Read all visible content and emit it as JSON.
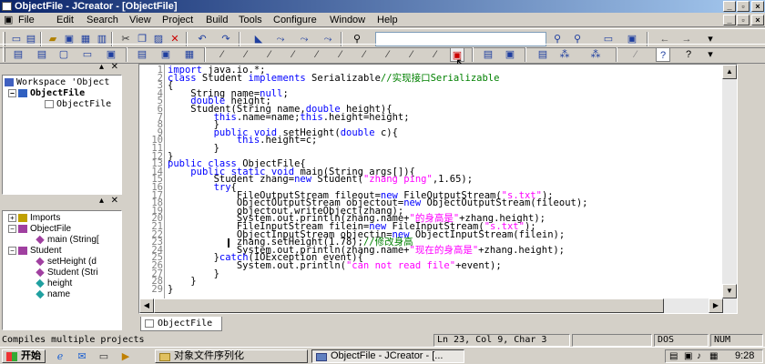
{
  "window": {
    "title": "ObjectFile - JCreator - [ObjectFile]"
  },
  "menu": [
    "File",
    "Edit",
    "Search",
    "View",
    "Project",
    "Build",
    "Tools",
    "Configure",
    "Window",
    "Help"
  ],
  "workspace": {
    "items": [
      "Workspace 'Object",
      "ObjectFile",
      "ObjectFile"
    ]
  },
  "classview": {
    "items": [
      "Imports",
      "ObjectFile",
      "main (String[",
      "Student",
      "setHeight (d",
      "Student (Stri",
      "height",
      "name"
    ]
  },
  "editor": {
    "line_numbers": [
      "1",
      "2",
      "3",
      "4",
      "5",
      "6",
      "7",
      "8",
      "9",
      "10",
      "11",
      "12",
      "13",
      "14",
      "15",
      "16",
      "17",
      "18",
      "19",
      "20",
      "21",
      "22",
      "23",
      "24",
      "25",
      "26",
      "27",
      "28",
      "29"
    ],
    "tab_label": "ObjectFile"
  },
  "code": {
    "l1a": "import",
    "l1b": " java.io.*;",
    "l2a": "class",
    "l2b": " Student ",
    "l2c": "implements",
    "l2d": " Serializable",
    "l2e": "//实现接口Serializable",
    "l3": "{",
    "l4a": "    String name=",
    "l4b": "null",
    "l4c": ";",
    "l5a": "    ",
    "l5b": "double",
    "l5c": " height;",
    "l6a": "    Student(String name,",
    "l6b": "double",
    "l6c": " height){",
    "l7a": "        ",
    "l7b": "this",
    "l7c": ".name=name;",
    "l7d": "this",
    "l7e": ".height=height;",
    "l8": "        }",
    "l9a": "        ",
    "l9b": "public",
    "l9c": " ",
    "l9d": "void",
    "l9e": " setHeight(",
    "l9f": "double",
    "l9g": " c){",
    "l10a": "            ",
    "l10b": "this",
    "l10c": ".height=c;",
    "l11": "        }",
    "l12": "}",
    "l13a": "public",
    "l13b": " ",
    "l13c": "class",
    "l13d": " ObjectFile{",
    "l14a": "    ",
    "l14b": "public",
    "l14c": " ",
    "l14d": "static",
    "l14e": " ",
    "l14f": "void",
    "l14g": " main(String args[]){",
    "l15a": "        Student zhang=",
    "l15b": "new",
    "l15c": " Student(",
    "l15d": "\"zhang ping\"",
    "l15e": ",1.65);",
    "l16a": "        ",
    "l16b": "try",
    "l16c": "{",
    "l17a": "            FileOutputStream fileout=",
    "l17b": "new",
    "l17c": " FileOutputStream(",
    "l17d": "\"s.txt\"",
    "l17e": ");",
    "l18a": "            ObjectOutputStream objectout=",
    "l18b": "new",
    "l18c": " ObjectOutputStream(fileout);",
    "l19": "            objectout.writeObject(zhang);",
    "l20a": "            System.out.println(zhang.name+",
    "l20b": "\"的身高是\"",
    "l20c": "+zhang.height);",
    "l21a": "            FileInputStream filein=",
    "l21b": "new",
    "l21c": " FileInputStream(",
    "l21d": "\"s.txt\"",
    "l21e": ");",
    "l22a": "            ObjectInputStream objectin=",
    "l22b": "new",
    "l22c": " ObjectInputStream(filein);",
    "l23a": "            zhang.setHeight(1.78);",
    "l23b": "//修改身高",
    "l24a": "            System.out.println(zhang.name+",
    "l24b": "\"现在的身高是\"",
    "l24c": "+zhang.height);",
    "l25a": "        }",
    "l25b": "catch",
    "l25c": "(IOException event){",
    "l26a": "            System.out.println(",
    "l26b": "\"can not read file\"",
    "l26c": "+event);",
    "l27": "        }",
    "l28": "    }",
    "l29": "}"
  },
  "status": {
    "message": "Compiles multiple projects",
    "position": "Ln 23, Col 9, Char 3",
    "mode": "DOS",
    "num": "NUM"
  },
  "taskbar": {
    "start": "开始",
    "task1": "对象文件序列化",
    "task2": "ObjectFile - JCreator - [...",
    "clock": "9:28"
  },
  "colors": {
    "keyword": "#0000ff",
    "string": "#ff00ff",
    "comment": "#008000",
    "titlebar": "#0a246a"
  }
}
